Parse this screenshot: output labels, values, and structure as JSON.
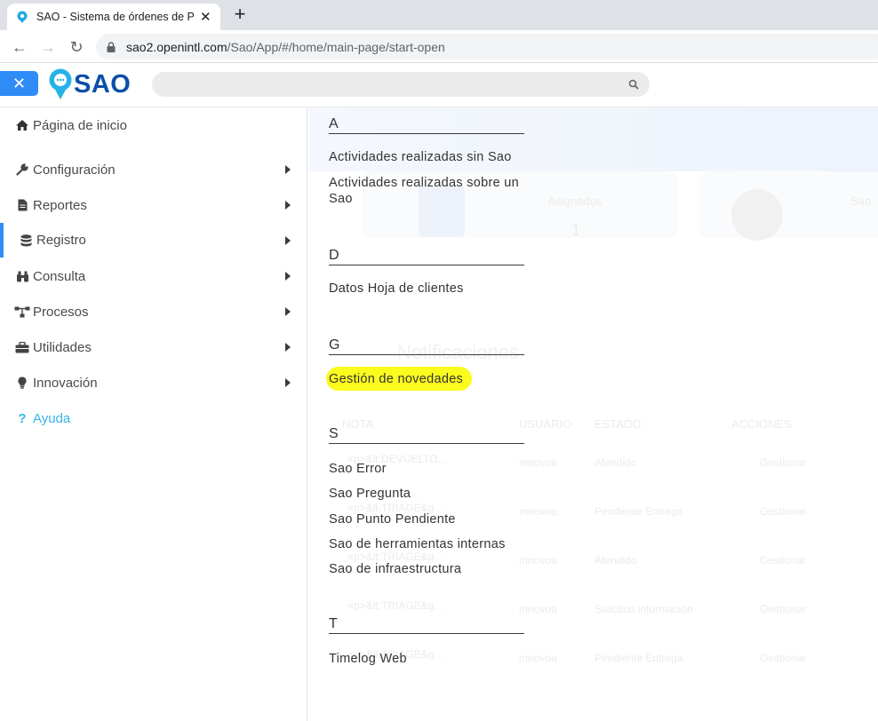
{
  "browser": {
    "tab_title": "SAO - Sistema de órdenes de Pro",
    "url_host": "sao2.openintl.com",
    "url_path": "/Sao/App/#/home/main-page/start-open"
  },
  "header": {
    "logo_text": "SAO",
    "search_placeholder": ""
  },
  "sidebar": {
    "items": [
      {
        "label": "Página de inicio",
        "icon": "home-icon"
      },
      {
        "label": "Configuración",
        "icon": "wrench-icon"
      },
      {
        "label": "Reportes",
        "icon": "document-icon"
      },
      {
        "label": "Registro",
        "icon": "database-icon"
      },
      {
        "label": "Consulta",
        "icon": "binoculars-icon"
      },
      {
        "label": "Procesos",
        "icon": "sitemap-icon"
      },
      {
        "label": "Utilidades",
        "icon": "toolbox-icon"
      },
      {
        "label": "Innovación",
        "icon": "lightbulb-icon"
      },
      {
        "label": "Ayuda",
        "icon": "question-icon"
      }
    ],
    "active_color": "#2f8cf7",
    "help_color": "#38b4e8"
  },
  "submenu": {
    "groups": [
      {
        "letter": "A",
        "entries": [
          "Actividades realizadas sin Sao",
          "Actividades realizadas sobre un Sao"
        ]
      },
      {
        "letter": "D",
        "entries": [
          "Datos Hoja de clientes"
        ]
      },
      {
        "letter": "G",
        "entries": [
          "Gestión de novedades"
        ]
      },
      {
        "letter": "S",
        "entries": [
          "Sao Error",
          "Sao Pregunta",
          "Sao Punto Pendiente",
          "Sao de herramientas internas",
          "Sao de infraestructura"
        ]
      },
      {
        "letter": "T",
        "entries": [
          "Timelog Web"
        ]
      }
    ],
    "highlight_color": "#fbfb1e"
  },
  "background": {
    "card_label": "Asignados",
    "card_value": "1",
    "card2_label": "Sao",
    "section_title": "Notificaciones",
    "columns": [
      "NOTA",
      "USUARIO",
      "ESTADO",
      "ACCIONES"
    ],
    "rows": [
      {
        "nota": "<p>&lt;DEVUELTO...",
        "usuario": "mnovoa",
        "estado": "Atendido",
        "accion": "Gestionar"
      },
      {
        "nota": "<p>&lt;TRIAGE&g...",
        "usuario": "mnovoa",
        "estado": "Pendiente Entrega",
        "accion": "Gestionar"
      },
      {
        "nota": "<p>&lt;TRIAGE&g...",
        "usuario": "mnovoa",
        "estado": "Atendido",
        "accion": "Gestionar"
      },
      {
        "nota": "<p>&lt;TRIAGE&g...",
        "usuario": "mnovoa",
        "estado": "Solicitud información",
        "accion": "Gestionar"
      },
      {
        "nota": "<p>&lt;TRIAGE&g...",
        "usuario": "mnovoa",
        "estado": "Pendiente Entrega",
        "accion": "Gestionar"
      }
    ]
  }
}
